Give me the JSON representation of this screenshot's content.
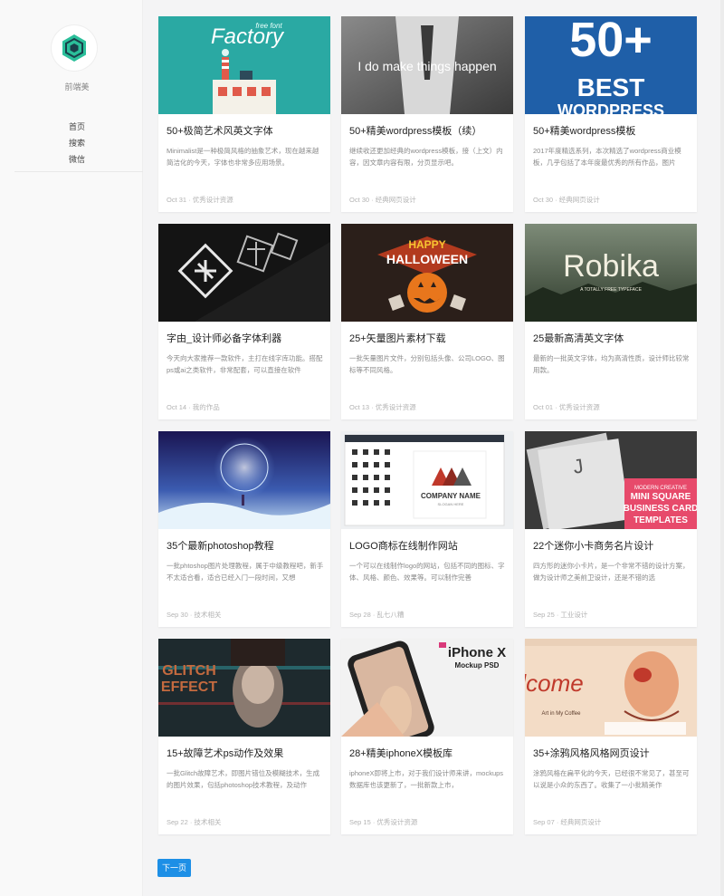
{
  "site": {
    "name": "前端美"
  },
  "nav": {
    "items": [
      "首页",
      "搜索",
      "微信"
    ]
  },
  "cards": [
    {
      "title": "50+极简艺术风英文字体",
      "excerpt": "Minimalist是一种极简风格的抽象艺术，现在越来越简洁化的今天，字体也非常多应用场景。",
      "meta": "Oct 31 · 优秀设计资源",
      "thumb_lines": [
        "Factory",
        "free font"
      ]
    },
    {
      "title": "50+精美wordpress模板（续）",
      "excerpt": "继续收还更加经典的wordpress模板，接（上文）内容，因文章内容有限，分页显示吧。",
      "meta": "Oct 30 · 经典网页设计",
      "thumb_lines": [
        "I do make things happen"
      ]
    },
    {
      "title": "50+精美wordpress模板",
      "excerpt": "2017年度精选系列，本次精选了wordpress商业模板，几乎包括了本年度最优秀的所有作品，图片",
      "meta": "Oct 30 · 经典网页设计",
      "thumb_lines": [
        "50+",
        "BEST",
        "WORDPRESS"
      ]
    },
    {
      "title": "字由_设计师必备字体利器",
      "excerpt": "今天向大家推荐一款软件，主打在线字库功能。搭配ps或ai之类软件，非常配套，可以直接在软件",
      "meta": "Oct 14 · 我的作品",
      "thumb_lines": []
    },
    {
      "title": "25+矢量图片素材下载",
      "excerpt": "一批矢量图片文件，分别包括头像、公司LOGO、图标等不同风格。",
      "meta": "Oct 13 · 优秀设计资源",
      "thumb_lines": [
        "HAPPY",
        "HALLOWEEN"
      ]
    },
    {
      "title": "25最新高清英文字体",
      "excerpt": "最新的一批英文字体，均为高清性质，设计师比较常用款。",
      "meta": "Oct 01 · 优秀设计资源",
      "thumb_lines": [
        "Robika",
        "A TOTALLY FREE TYPEFACE"
      ]
    },
    {
      "title": "35个最新photoshop教程",
      "excerpt": "一批phtoshop图片处理教程，属于中级教程吧，新手不太适合看，适合已经入门一段时间，又想",
      "meta": "Sep 30 · 技术相关",
      "thumb_lines": []
    },
    {
      "title": "LOGO商标在线制作网站",
      "excerpt": "一个可以在线制作logo的网站，包括不同的图标、字体、风格、颜色、效果等。可以制作完善",
      "meta": "Sep 28 · 乱七八糟",
      "thumb_lines": [
        "COMPANY NAME",
        "SLOGAN HERE"
      ]
    },
    {
      "title": "22个迷你小卡商务名片设计",
      "excerpt": "四方形的迷你小卡片，是一个非常不错的设计方案，做为设计师之美前卫设计，还是不错的选",
      "meta": "Sep 25 · 工业设计",
      "thumb_lines": [
        "MODERN CREATIVE",
        "MINI SQUARE",
        "BUSINESS CARD",
        "TEMPLATES"
      ]
    },
    {
      "title": "15+故障艺术ps动作及效果",
      "excerpt": "一批Glitch故障艺术，即图片错位及模糊技术，生成的图片效果，包括photoshop技术教程，及动作",
      "meta": "Sep 22 · 技术相关",
      "thumb_lines": [
        "GLITCH",
        "EFFECT"
      ]
    },
    {
      "title": "28+精美iphoneX模板库",
      "excerpt": "iphoneX即将上市，对于我们设计师来讲，mockups数据库也该更新了，一批新款上市，",
      "meta": "Sep 15 · 优秀设计资源",
      "thumb_lines": [
        "iPhone X",
        "Mockup PSD"
      ]
    },
    {
      "title": "35+涂鸦风格风格网页设计",
      "excerpt": "涂鸦风格在扁平化的今天，已经很不常见了，甚至可以说是小众的东西了。收集了一小批精美作",
      "meta": "Sep 07 · 经典网页设计",
      "thumb_lines": [
        "lcome",
        "Art in My Coffee"
      ]
    }
  ],
  "pagination": {
    "next_label": "下一页"
  }
}
